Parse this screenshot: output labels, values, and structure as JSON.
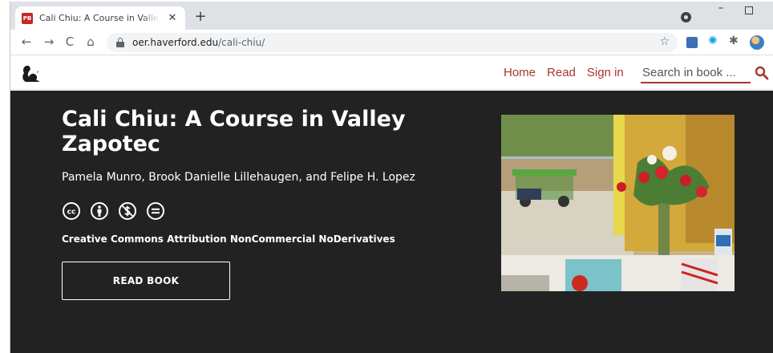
{
  "browser": {
    "tab_title": "Cali Chiu: A Course in Valley Zapo",
    "tab_favicon": "PB",
    "tab_close": "✕",
    "new_tab": "+",
    "url_host": "oer.haverford.edu",
    "url_path": "/cali-chiu/",
    "nav": {
      "back": "←",
      "forward": "→",
      "reload": "C",
      "home": "⌂"
    },
    "star": "☆",
    "window_min": "–"
  },
  "site": {
    "nav": [
      "Home",
      "Read",
      "Sign in"
    ],
    "search_placeholder": "Search in book ...",
    "accent_color": "#a8362f"
  },
  "book": {
    "title": "Cali Chiu: A Course in Valley Zapotec",
    "authors": "Pamela Munro, Brook Danielle Lillehaugen, and Felipe H. Lopez",
    "license": "Creative Commons Attribution NonCommercial NoDerivatives",
    "read_button": "READ BOOK"
  },
  "icons": {
    "cc": [
      "cc-icon",
      "attribution-icon",
      "noncommercial-icon",
      "noderivatives-icon"
    ],
    "cc_labels": {
      "cc": "cc",
      "noderivatives": "="
    }
  }
}
